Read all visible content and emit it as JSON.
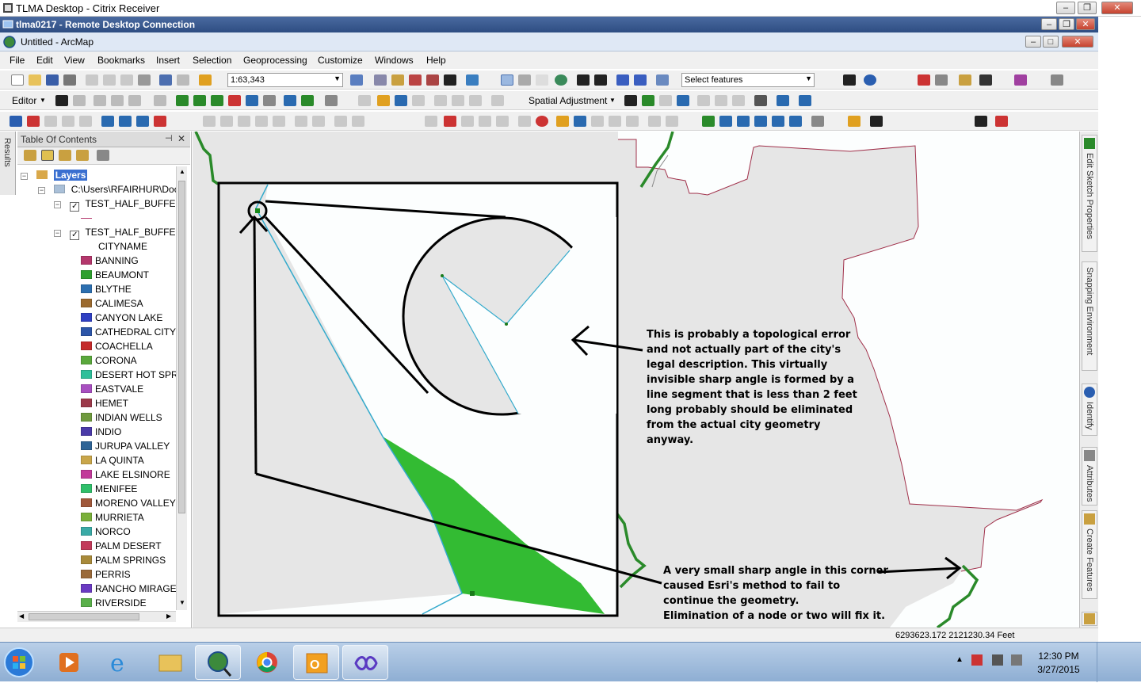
{
  "citrix": {
    "title": "TLMA Desktop - Citrix Receiver"
  },
  "rdc": {
    "title": "tlma0217 - Remote Desktop Connection"
  },
  "arcmap": {
    "title": "Untitled - ArcMap"
  },
  "menu": [
    "File",
    "Edit",
    "View",
    "Bookmarks",
    "Insert",
    "Selection",
    "Geoprocessing",
    "Customize",
    "Windows",
    "Help"
  ],
  "toolbar": {
    "scale": "1:63,343",
    "select_features": "Select features",
    "editor": "Editor",
    "spatial_adjustment": "Spatial Adjustment"
  },
  "toc": {
    "title": "Table Of Contents",
    "results_tab": "Results",
    "layers_label": "Layers",
    "path": "C:\\Users\\RFAIRHUR\\Docu",
    "layer1": "TEST_HALF_BUFFERS",
    "layer2": "TEST_HALF_BUFFERS_",
    "field": "CITYNAME",
    "cities": [
      {
        "name": "BANNING",
        "color": "#b4376c"
      },
      {
        "name": "BEAUMONT",
        "color": "#2ea02e"
      },
      {
        "name": "BLYTHE",
        "color": "#2c6fb0"
      },
      {
        "name": "CALIMESA",
        "color": "#9b6a2f"
      },
      {
        "name": "CANYON LAKE",
        "color": "#2f3fc2"
      },
      {
        "name": "CATHEDRAL CITY",
        "color": "#2c55a8"
      },
      {
        "name": "COACHELLA",
        "color": "#c42a2a"
      },
      {
        "name": "CORONA",
        "color": "#5aa83c"
      },
      {
        "name": "DESERT HOT SPRIN",
        "color": "#2fbf9a"
      },
      {
        "name": "EASTVALE",
        "color": "#a84fc0"
      },
      {
        "name": "HEMET",
        "color": "#9c3a4a"
      },
      {
        "name": "INDIAN WELLS",
        "color": "#6f9a3e"
      },
      {
        "name": "INDIO",
        "color": "#4a3aa8"
      },
      {
        "name": "JURUPA VALLEY",
        "color": "#2f6496"
      },
      {
        "name": "LA QUINTA",
        "color": "#c9a64a"
      },
      {
        "name": "LAKE ELSINORE",
        "color": "#c23a9a"
      },
      {
        "name": "MENIFEE",
        "color": "#2fbf6a"
      },
      {
        "name": "MORENO VALLEY",
        "color": "#a0583a"
      },
      {
        "name": "MURRIETA",
        "color": "#7ab03a"
      },
      {
        "name": "NORCO",
        "color": "#3aaaa6"
      },
      {
        "name": "PALM DESERT",
        "color": "#c23a5a"
      },
      {
        "name": "PALM SPRINGS",
        "color": "#a88a3a"
      },
      {
        "name": "PERRIS",
        "color": "#9a6a3a"
      },
      {
        "name": "RANCHO MIRAGE",
        "color": "#6a3ac2"
      },
      {
        "name": "RIVERSIDE",
        "color": "#5ab04a"
      }
    ]
  },
  "dock_tabs": [
    "Edit Sketch Properties",
    "Snapping Environment",
    "Identify",
    "Attributes",
    "Create Features"
  ],
  "annotations": {
    "note1": [
      "This is probably a topological error",
      "and not actually part of the city's",
      "legal description.  This virtually",
      "invisible sharp angle  is formed by a",
      "line segment that is less than 2 feet",
      "long probably should be eliminated",
      "from the actual city geometry",
      "anyway."
    ],
    "note2": [
      "A very small sharp angle in this corner",
      "caused Esri's method to fail to",
      "continue the geometry.",
      "Elimination of a node or two will fix it."
    ]
  },
  "status": {
    "coords": "6293623.172  2121230.34 Feet"
  },
  "clock": {
    "time": "12:30 PM",
    "date": "3/27/2015"
  },
  "taskbar_apps": [
    "start-orb",
    "media-player",
    "internet-explorer",
    "file-explorer",
    "arcmap",
    "chrome",
    "outlook",
    "remote-app"
  ]
}
